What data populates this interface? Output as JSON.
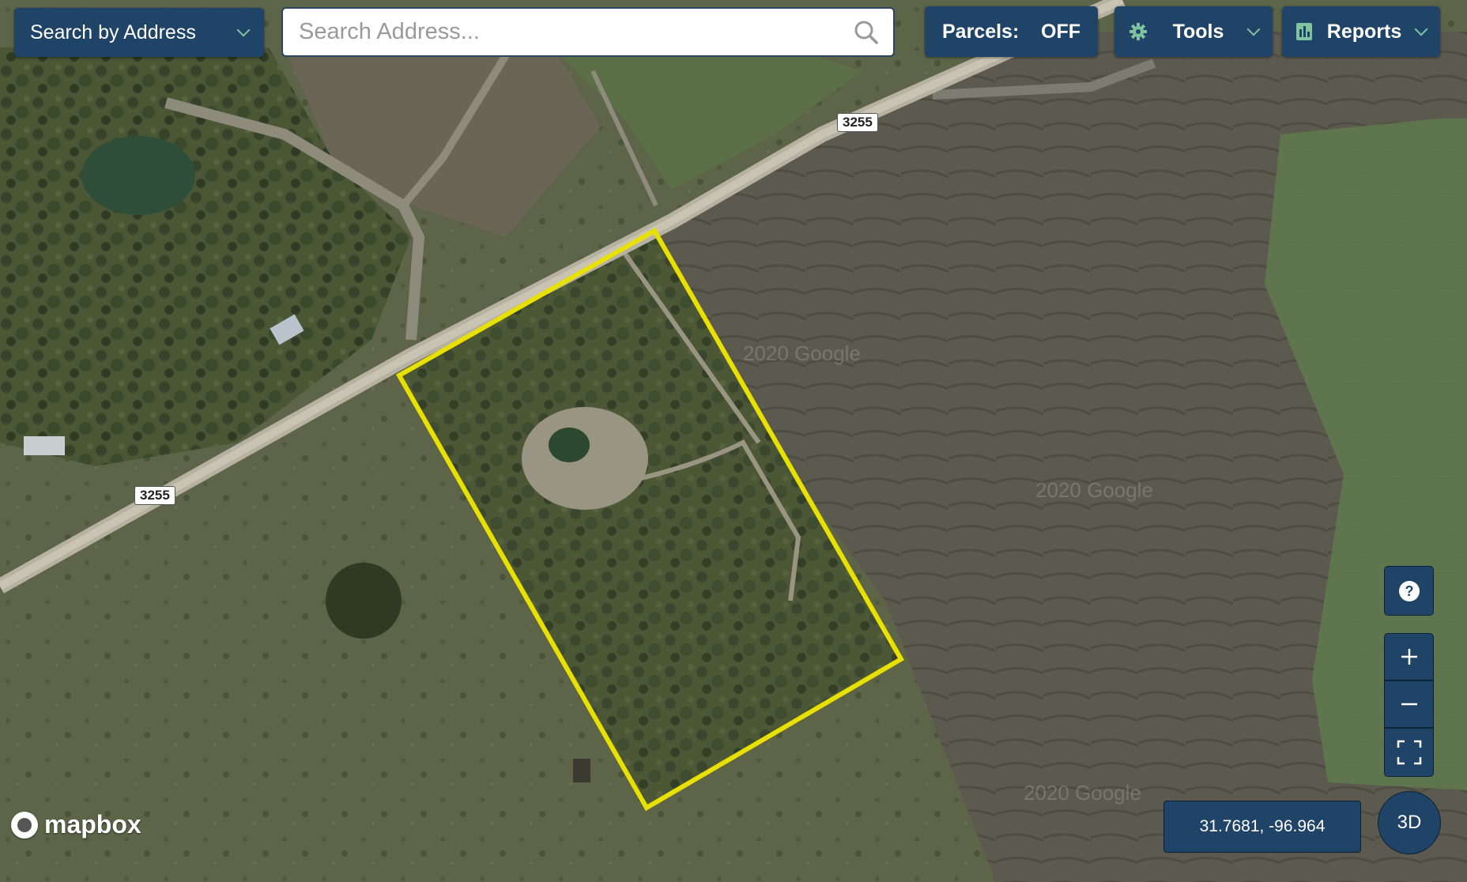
{
  "toolbar": {
    "search_mode_label": "Search by Address",
    "search_placeholder": "Search Address...",
    "parcels_label": "Parcels:",
    "parcels_state": "OFF",
    "tools_label": "Tools",
    "reports_label": "Reports"
  },
  "map": {
    "road_labels": [
      "3255",
      "3255"
    ],
    "watermarks": [
      "2020 Google",
      "2020 Google",
      "2020 Google"
    ],
    "coordinates": "31.7681, -96.964",
    "button_3d": "3D",
    "attribution": "mapbox",
    "parcel_outline_color": "#e8e000"
  },
  "controls": {
    "help_icon": "question-icon",
    "zoom_in_icon": "plus-icon",
    "zoom_out_icon": "minus-icon",
    "fullscreen_icon": "fullscreen-icon"
  }
}
